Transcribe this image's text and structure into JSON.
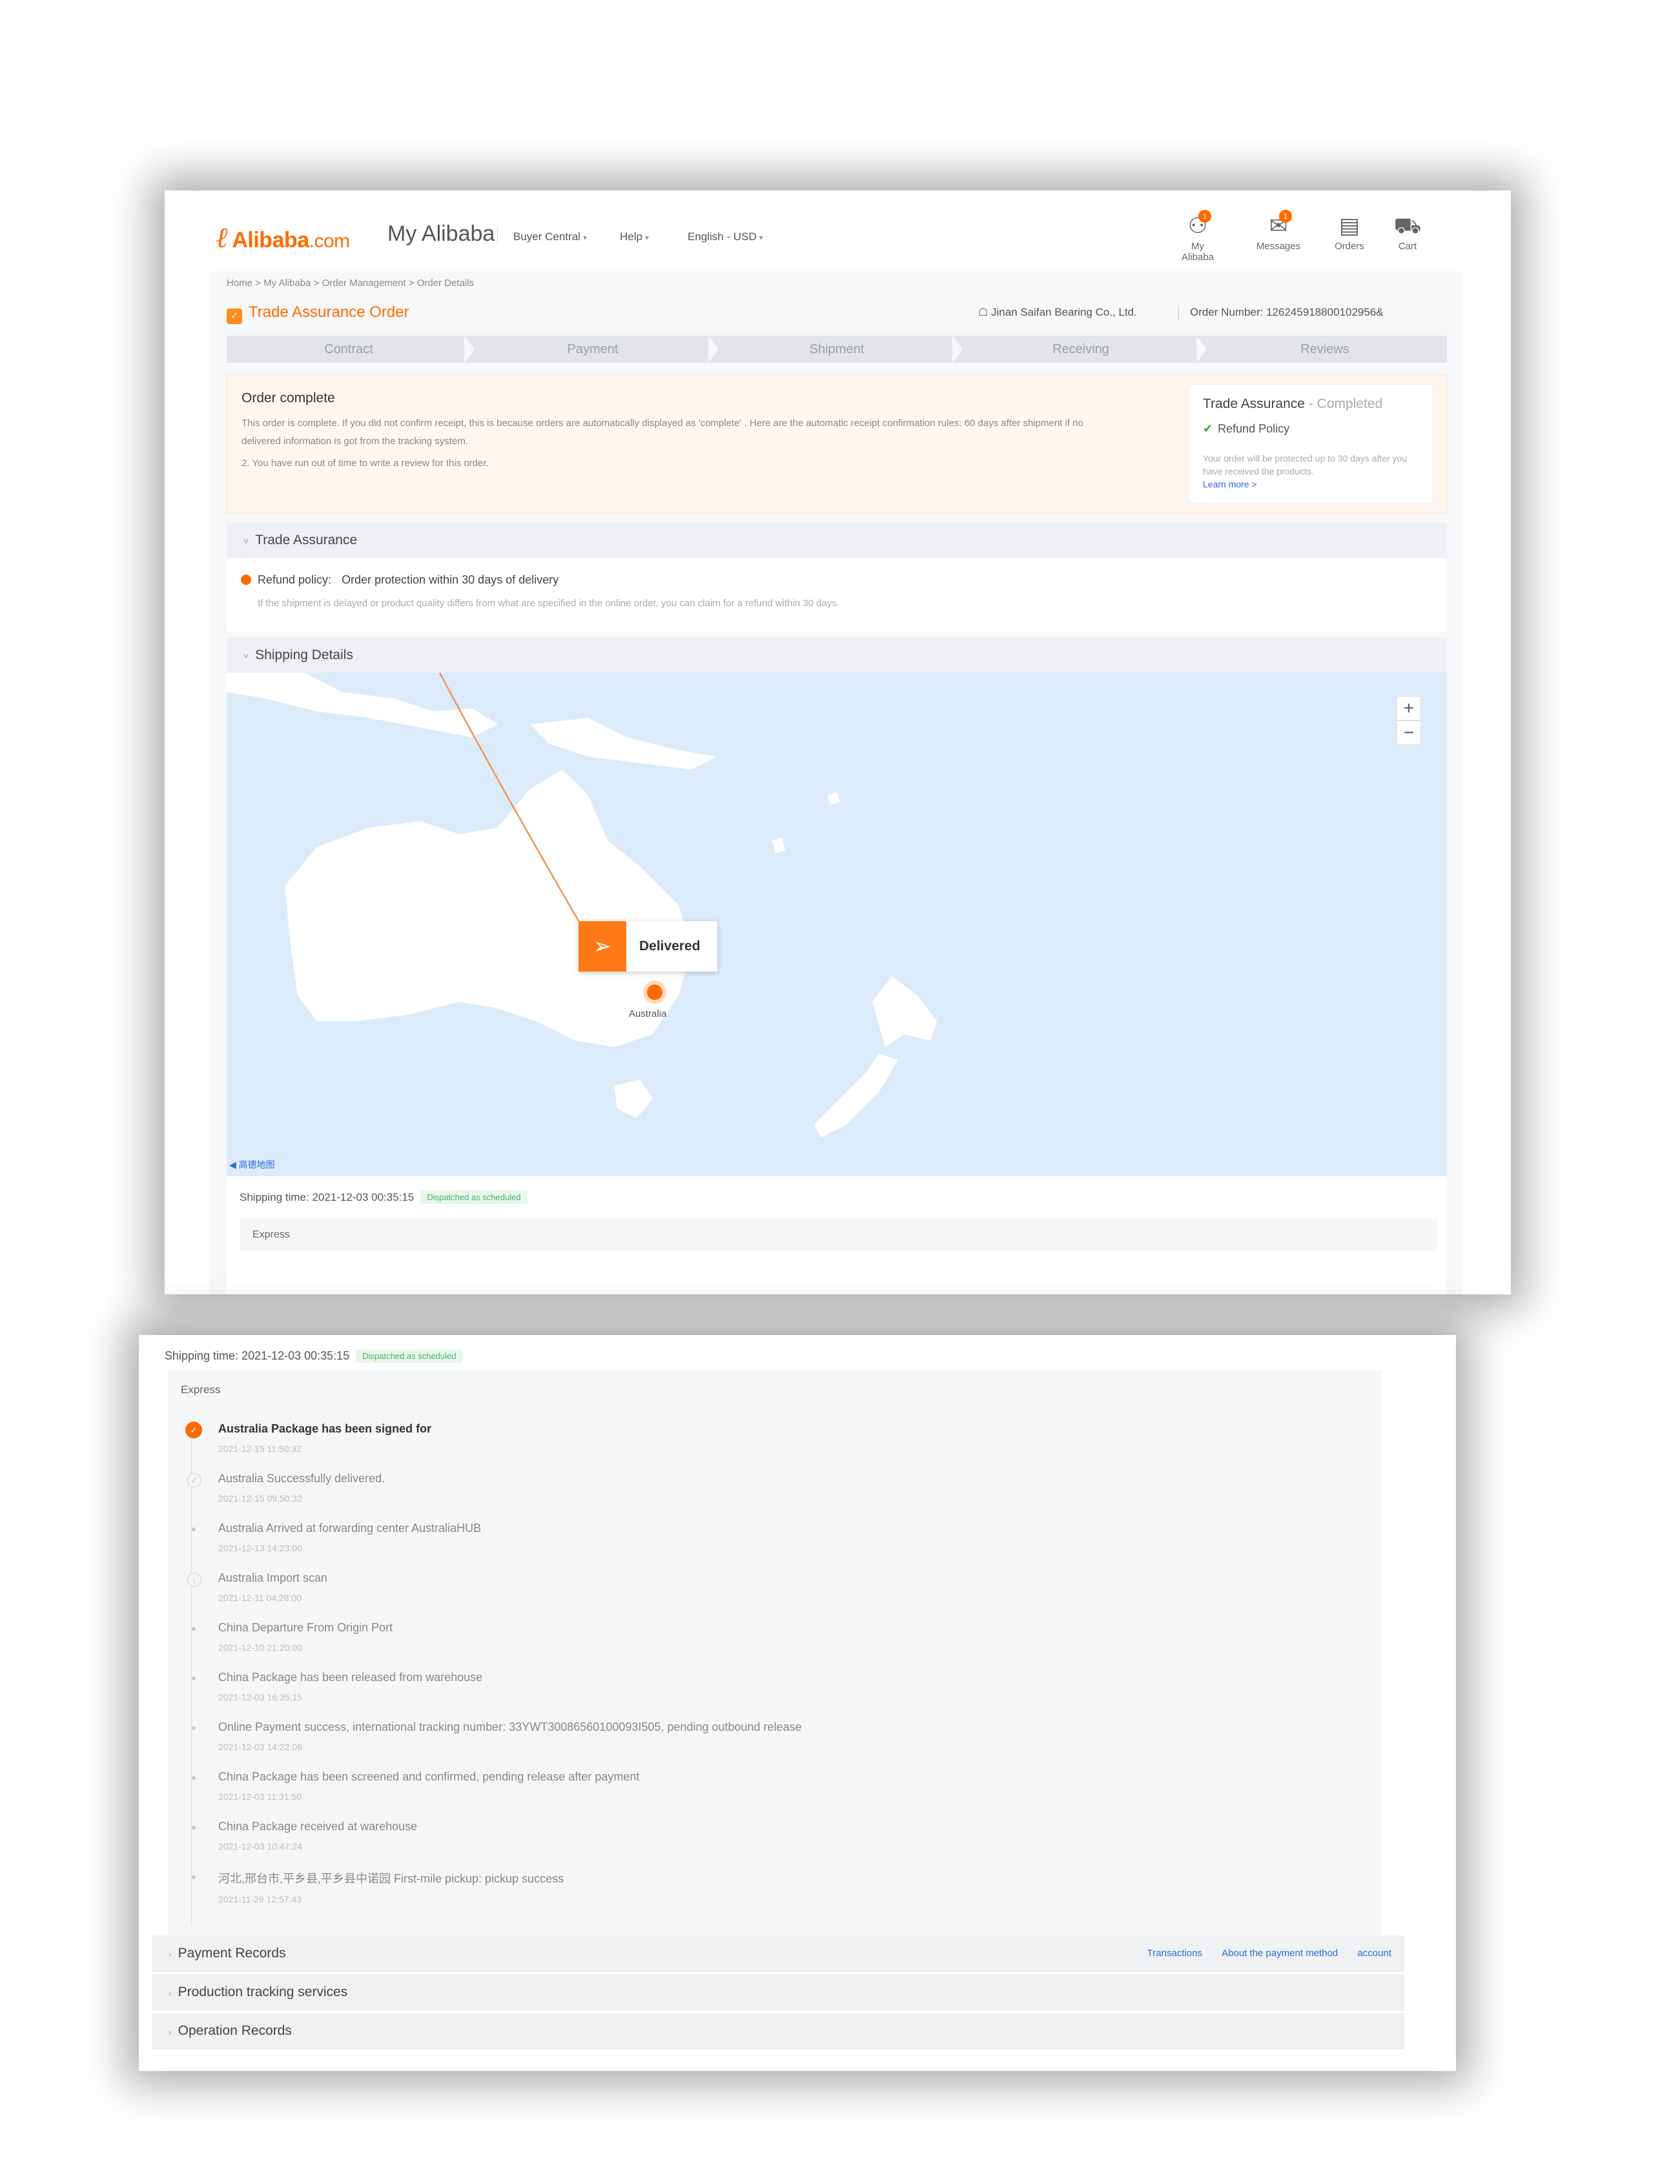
{
  "header": {
    "logo": "Alibaba",
    "logo_suffix": ".com",
    "title": "My Alibaba",
    "nav": [
      "Buyer Central",
      "Help",
      "English - USD"
    ],
    "icons": [
      {
        "label": "My Alibaba",
        "icon": "user-icon",
        "badge": "1"
      },
      {
        "label": "Messages",
        "icon": "messages-icon",
        "badge": "1"
      },
      {
        "label": "Orders",
        "icon": "orders-icon",
        "badge": ""
      },
      {
        "label": "Cart",
        "icon": "cart-icon",
        "badge": ""
      }
    ]
  },
  "breadcrumb": "Home  >  My Alibaba  >  Order Management  >  Order Details",
  "page_title": "Trade Assurance Order",
  "supplier": "Jinan Saifan Bearing Co., Ltd.",
  "order_number": "Order Number: 126245918800102956&",
  "steps": [
    "Contract",
    "Payment",
    "Shipment",
    "Receiving",
    "Reviews"
  ],
  "notice": {
    "title": "Order complete",
    "line1": "This order is complete. If you did not confirm receipt, this is because orders are automatically displayed as 'complete' . Here are the automatic receipt confirmation rules: 60 days after shipment if no",
    "line2": "delivered information is got from the tracking system.",
    "line3": "2. You have run out of time to write a review for this order."
  },
  "ta_box": {
    "title": "Trade Assurance",
    "status": "- Completed",
    "policy": "Refund Policy",
    "desc": "Your order will be protected up to 30 days after you have received the products.",
    "link": "Learn more >"
  },
  "trade_assurance": {
    "heading": "Trade Assurance",
    "refund_label": "Refund policy:",
    "refund_value": "Order protection within 30 days of delivery",
    "refund_desc": "If the shipment is delayed or product quality differs from what are specified in the online order, you can claim for a refund within 30 days."
  },
  "shipping": {
    "heading": "Shipping Details",
    "delivered_label": "Delivered",
    "map_location": "Australia",
    "map_provider": "高德地图",
    "zoom_in": "+",
    "zoom_out": "−",
    "time_label": "Shipping time: 2021-12-03 00:35:15",
    "time_tag": "Dispatched as scheduled",
    "express_label": "Express"
  },
  "events": [
    {
      "text": "Australia Package has been signed for",
      "date": "2021-12-15 11:50:32",
      "mark": "active"
    },
    {
      "text": "Australia Successfully delivered.",
      "date": "2021-12-15 09:50:32",
      "mark": "ring"
    },
    {
      "text": "Australia Arrived at forwarding center AustraliaHUB",
      "date": "2021-12-13 14:23:00",
      "mark": "dot"
    },
    {
      "text": "Australia Import scan",
      "date": "2021-12-11 04:28:00",
      "mark": "ring"
    },
    {
      "text": "China Departure From Origin Port",
      "date": "2021-12-10 21:20:00",
      "mark": "dot"
    },
    {
      "text": "China Package has been released from warehouse",
      "date": "2021-12-03 16:35:15",
      "mark": "dot"
    },
    {
      "text": "Online Payment success, international tracking number: 33YWT30086560100093I505, pending outbound release",
      "date": "2021-12-03 14:22:06",
      "mark": "dot"
    },
    {
      "text": "China Package has been screened and confirmed, pending release after payment",
      "date": "2021-12-03 11:31:50",
      "mark": "dot"
    },
    {
      "text": "China Package received at warehouse",
      "date": "2021-12-03 10:47:24",
      "mark": "dot"
    },
    {
      "text": "河北,邢台市,平乡县,平乡县中诺园 First-mile pickup: pickup success",
      "date": "2021-11-29 12:57:43",
      "mark": "dot"
    }
  ],
  "records": {
    "payment": "Payment Records",
    "payment_links": [
      "Transactions",
      "About the payment method",
      "account"
    ],
    "production": "Production tracking services",
    "operation": "Operation Records"
  }
}
